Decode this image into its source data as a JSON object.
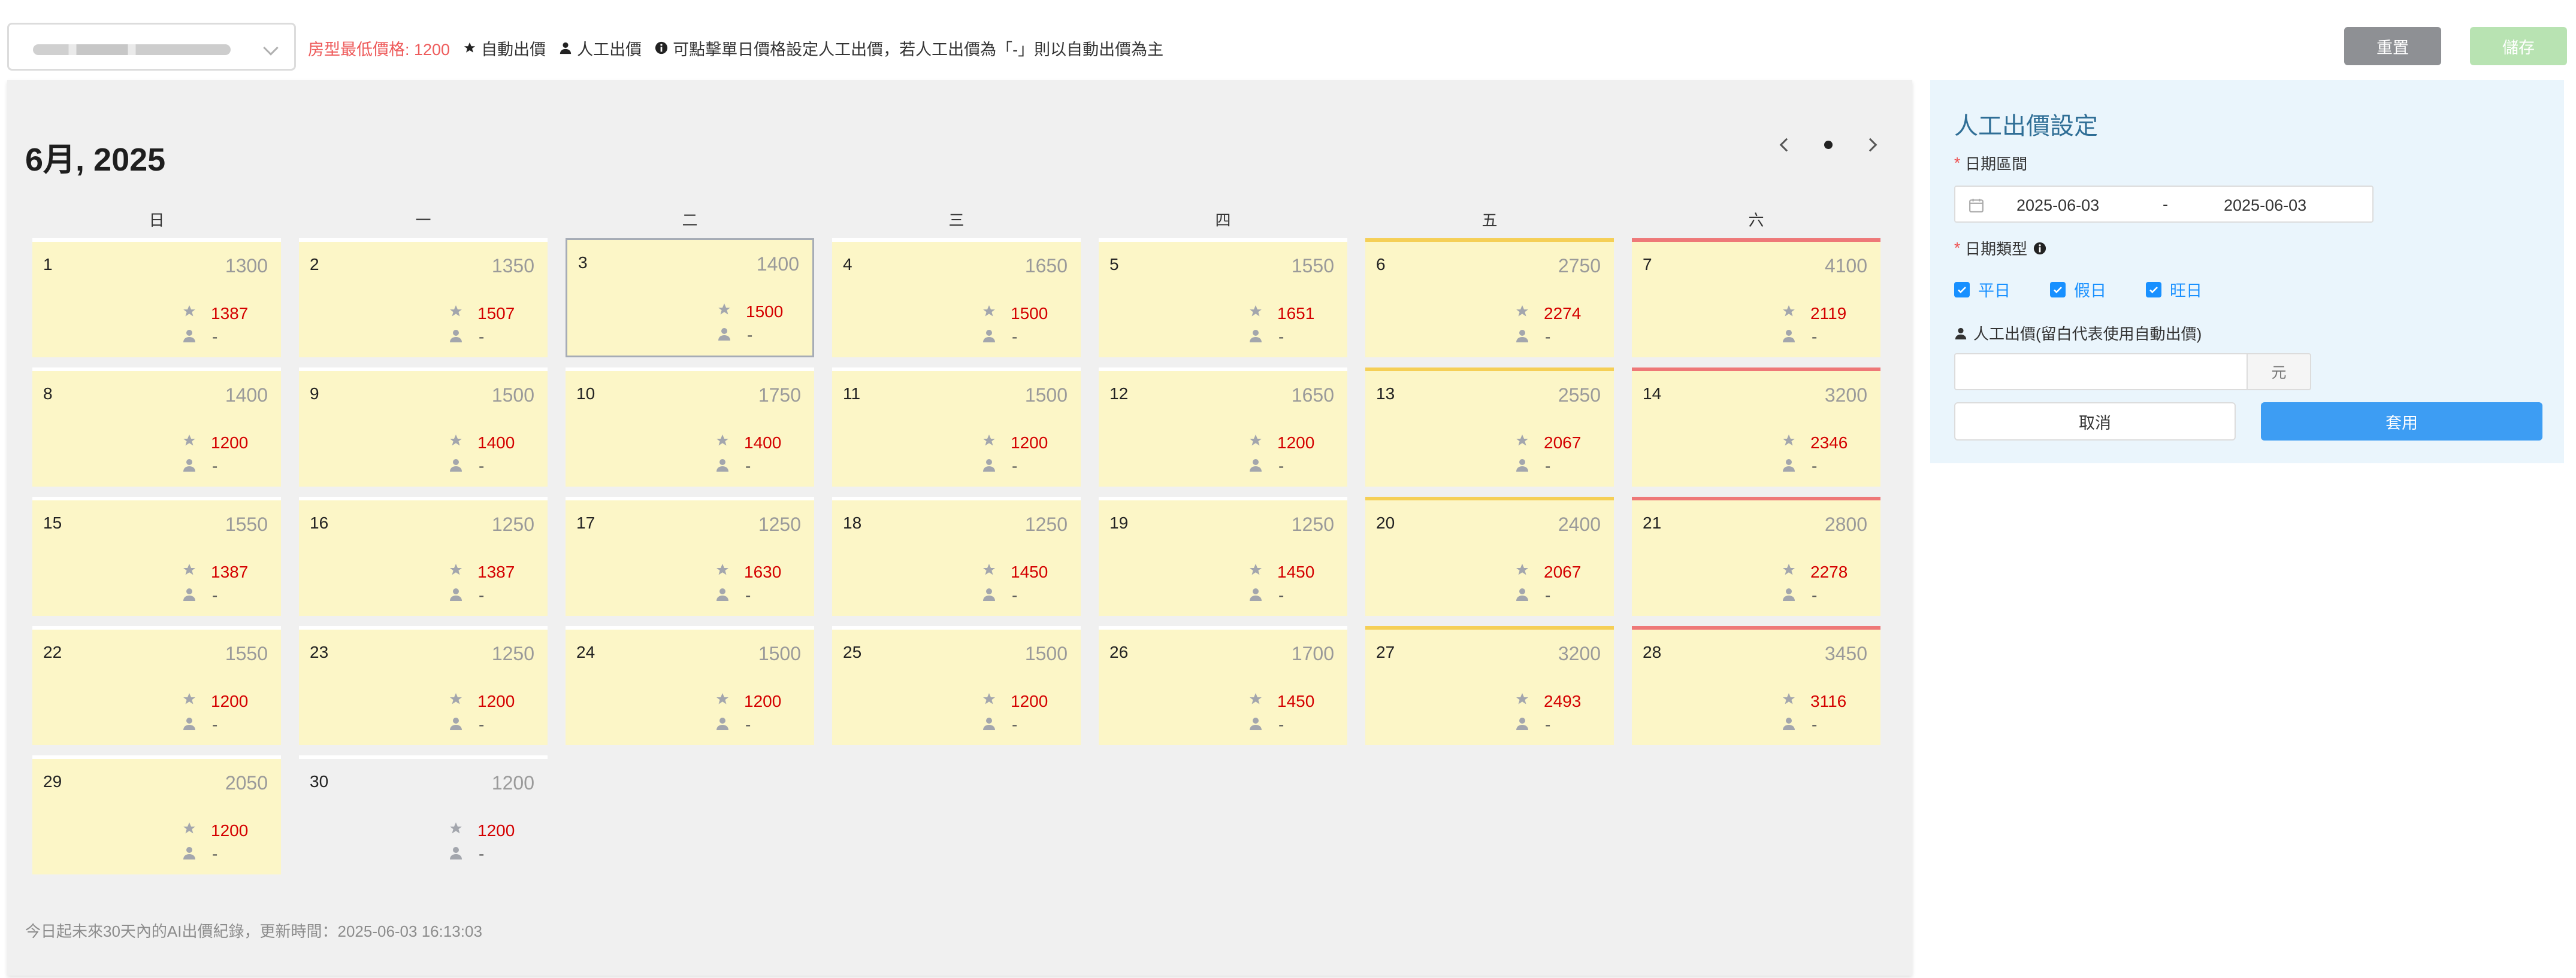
{
  "toolbar": {
    "room_select_value": "",
    "min_price_text": "房型最低價格: 1200",
    "legend_auto": "自動出價",
    "legend_manual": "人工出價",
    "legend_note": "可點擊單日價格設定人工出價，若人工出價為「-」則以自動出價為主",
    "reset_label": "重置",
    "save_label": "儲存",
    "colors": {
      "reset": "#8e9094",
      "save_disabled": "#b8e3b2"
    }
  },
  "calendar": {
    "title": "6月, 2025",
    "weekdays": [
      "日",
      "一",
      "二",
      "三",
      "四",
      "五",
      "六"
    ],
    "selected_day": 3,
    "days": [
      {
        "day": "1",
        "base": "1300",
        "auto": "1387",
        "manual": "-"
      },
      {
        "day": "2",
        "base": "1350",
        "auto": "1507",
        "manual": "-"
      },
      {
        "day": "3",
        "base": "1400",
        "auto": "1500",
        "manual": "-"
      },
      {
        "day": "4",
        "base": "1650",
        "auto": "1500",
        "manual": "-"
      },
      {
        "day": "5",
        "base": "1550",
        "auto": "1651",
        "manual": "-"
      },
      {
        "day": "6",
        "base": "2750",
        "auto": "2274",
        "manual": "-"
      },
      {
        "day": "7",
        "base": "4100",
        "auto": "2119",
        "manual": "-"
      },
      {
        "day": "8",
        "base": "1400",
        "auto": "1200",
        "manual": "-"
      },
      {
        "day": "9",
        "base": "1500",
        "auto": "1400",
        "manual": "-"
      },
      {
        "day": "10",
        "base": "1750",
        "auto": "1400",
        "manual": "-"
      },
      {
        "day": "11",
        "base": "1500",
        "auto": "1200",
        "manual": "-"
      },
      {
        "day": "12",
        "base": "1650",
        "auto": "1200",
        "manual": "-"
      },
      {
        "day": "13",
        "base": "2550",
        "auto": "2067",
        "manual": "-"
      },
      {
        "day": "14",
        "base": "3200",
        "auto": "2346",
        "manual": "-"
      },
      {
        "day": "15",
        "base": "1550",
        "auto": "1387",
        "manual": "-"
      },
      {
        "day": "16",
        "base": "1250",
        "auto": "1387",
        "manual": "-"
      },
      {
        "day": "17",
        "base": "1250",
        "auto": "1630",
        "manual": "-"
      },
      {
        "day": "18",
        "base": "1250",
        "auto": "1450",
        "manual": "-"
      },
      {
        "day": "19",
        "base": "1250",
        "auto": "1450",
        "manual": "-"
      },
      {
        "day": "20",
        "base": "2400",
        "auto": "2067",
        "manual": "-"
      },
      {
        "day": "21",
        "base": "2800",
        "auto": "2278",
        "manual": "-"
      },
      {
        "day": "22",
        "base": "1550",
        "auto": "1200",
        "manual": "-"
      },
      {
        "day": "23",
        "base": "1250",
        "auto": "1200",
        "manual": "-"
      },
      {
        "day": "24",
        "base": "1500",
        "auto": "1200",
        "manual": "-"
      },
      {
        "day": "25",
        "base": "1500",
        "auto": "1200",
        "manual": "-"
      },
      {
        "day": "26",
        "base": "1700",
        "auto": "1450",
        "manual": "-"
      },
      {
        "day": "27",
        "base": "3200",
        "auto": "2493",
        "manual": "-"
      },
      {
        "day": "28",
        "base": "3450",
        "auto": "3116",
        "manual": "-"
      },
      {
        "day": "29",
        "base": "2050",
        "auto": "1200",
        "manual": "-"
      },
      {
        "day": "30",
        "base": "1200",
        "auto": "1200",
        "manual": "-"
      }
    ],
    "footnote": "今日起未來30天內的AI出價紀錄，更新時間：2025-06-03 16:13:03",
    "colors": {
      "cell": "#fcf6c7",
      "friday_bar": "#f5cf56",
      "saturday_bar": "#ee7878",
      "auto_price": "#d40000"
    }
  },
  "manual_panel": {
    "title": "人工出價設定",
    "date_range_label": "日期區間",
    "date_start": "2025-06-03",
    "date_separator": "-",
    "date_end": "2025-06-03",
    "date_type_label": "日期類型",
    "date_types": [
      "平日",
      "假日",
      "旺日"
    ],
    "price_label": "人工出價(留白代表使用自動出價)",
    "price_value": "",
    "price_unit": "元",
    "cancel_label": "取消",
    "apply_label": "套用",
    "colors": {
      "panel_bg": "#eaf5fc",
      "apply": "#3d9df3",
      "title": "#2f6e96"
    }
  }
}
